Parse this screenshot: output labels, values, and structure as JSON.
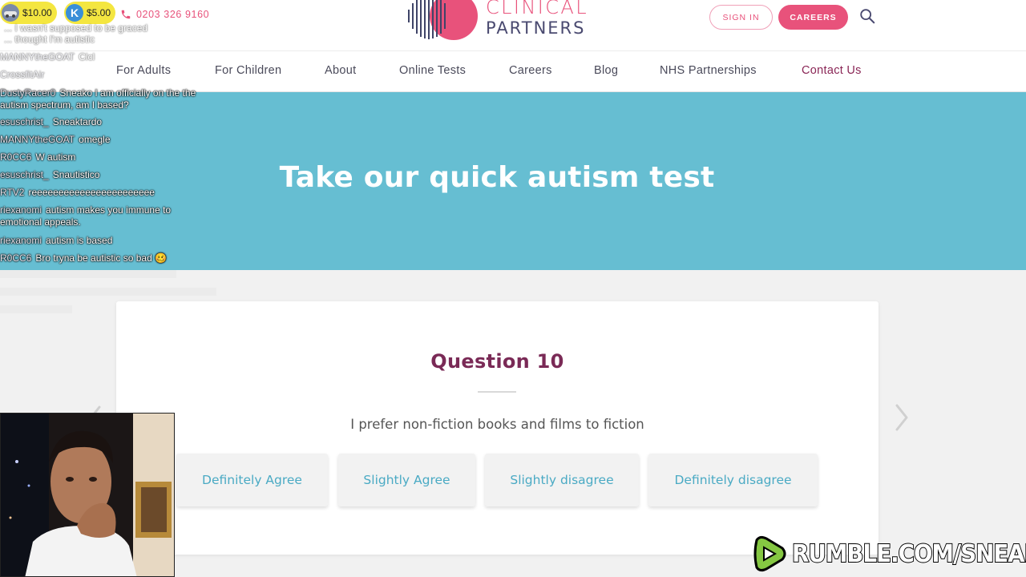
{
  "header": {
    "phone": "0203 326 9160",
    "logo": {
      "line1": "CLINICAL",
      "line2": "PARTNERS"
    },
    "signin_label": "SIGN IN",
    "careers_label": "CAREERS",
    "icons": {
      "phone": "phone-icon",
      "search": "search-icon"
    }
  },
  "nav": {
    "items": [
      {
        "label": "For Adults"
      },
      {
        "label": "For Children"
      },
      {
        "label": "About"
      },
      {
        "label": "Online Tests"
      },
      {
        "label": "Careers"
      },
      {
        "label": "Blog"
      },
      {
        "label": "NHS Partnerships"
      },
      {
        "label": "Contact Us"
      }
    ]
  },
  "hero": {
    "title": "Take our quick autism test"
  },
  "quiz": {
    "question_title": "Question 10",
    "question_text": "I prefer non-fiction books and films to fiction",
    "answers": [
      {
        "label": "Definitely Agree"
      },
      {
        "label": "Slightly Agree"
      },
      {
        "label": "Slightly disagree"
      },
      {
        "label": "Definitely disagree"
      }
    ]
  },
  "overlay": {
    "donations": [
      {
        "amount": "$10.00",
        "avatar": ""
      },
      {
        "amount": "$5.00",
        "avatar": "K"
      }
    ],
    "chat": [
      {
        "user": "",
        "message": "... I wasn't supposed to be graced"
      },
      {
        "user": "",
        "message": "... thought I'm autistic"
      },
      {
        "user": "MANNYtheGOAT",
        "message": "Clcl"
      },
      {
        "user": "CrossfitAir",
        "message": ""
      },
      {
        "user": "DustyRacer0",
        "message": "Sneako I am officially on the the autism spectrum, am I based?"
      },
      {
        "user": "esuschrist_",
        "message": "Sneaktardo"
      },
      {
        "user": "MANNYtheGOAT",
        "message": "omegle"
      },
      {
        "user": "R0CC6",
        "message": "W autism"
      },
      {
        "user": "esuschrist_",
        "message": "Snautistico"
      },
      {
        "user": "RTV2",
        "message": "reeeeeeeeeeeeeeeeeeeeeee"
      },
      {
        "user": "riexanomi",
        "message": "autism makes you immune to emotional appeals."
      },
      {
        "user": "riexanomi",
        "message": "autism is based"
      },
      {
        "user": "R0CC6",
        "message": "Bro tryna be autistic so bad 🥴"
      }
    ],
    "watermark": "RUMBLE.COM/SNEAKO",
    "colors": {
      "donation": "#f4e640",
      "rumble_green": "#85c742"
    }
  },
  "colors": {
    "brand_pink": "#e8527b",
    "hero_teal": "#66bed2",
    "question_purple": "#7a2a56",
    "answer_text": "#4aaac4"
  }
}
